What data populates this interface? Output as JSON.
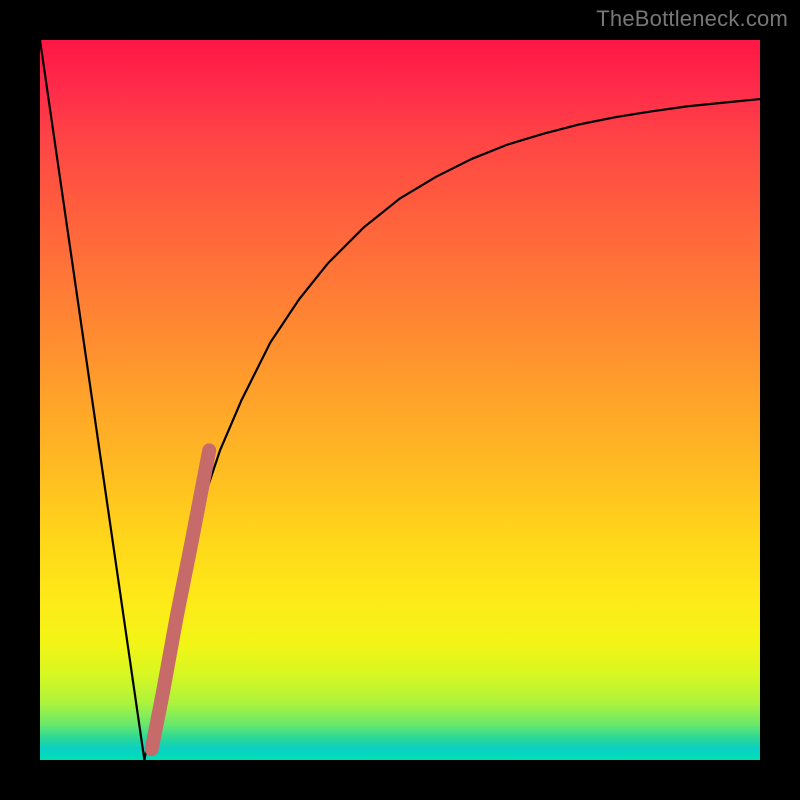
{
  "watermark": "TheBottleneck.com",
  "colors": {
    "curve_black": "#000000",
    "accent_line": "#c76a6a",
    "frame": "#000000"
  },
  "chart_data": {
    "type": "line",
    "title": "",
    "xlabel": "",
    "ylabel": "",
    "xlim": [
      0,
      100
    ],
    "ylim": [
      0,
      100
    ],
    "grid": false,
    "series": [
      {
        "name": "left-slope",
        "x": [
          0,
          14.5
        ],
        "y": [
          100,
          0
        ]
      },
      {
        "name": "main-curve",
        "x": [
          14.5,
          16,
          18,
          20,
          22,
          25,
          28,
          32,
          36,
          40,
          45,
          50,
          55,
          60,
          65,
          70,
          75,
          80,
          85,
          90,
          95,
          100
        ],
        "y": [
          0,
          8,
          18,
          27,
          34,
          43,
          50,
          58,
          64,
          69,
          74,
          78,
          81,
          83.5,
          85.5,
          87,
          88.3,
          89.3,
          90.1,
          90.8,
          91.3,
          91.8
        ]
      },
      {
        "name": "accent-segment",
        "x": [
          15.5,
          17,
          19,
          21,
          23.5
        ],
        "y": [
          1.5,
          9,
          20,
          30,
          43
        ]
      }
    ]
  }
}
